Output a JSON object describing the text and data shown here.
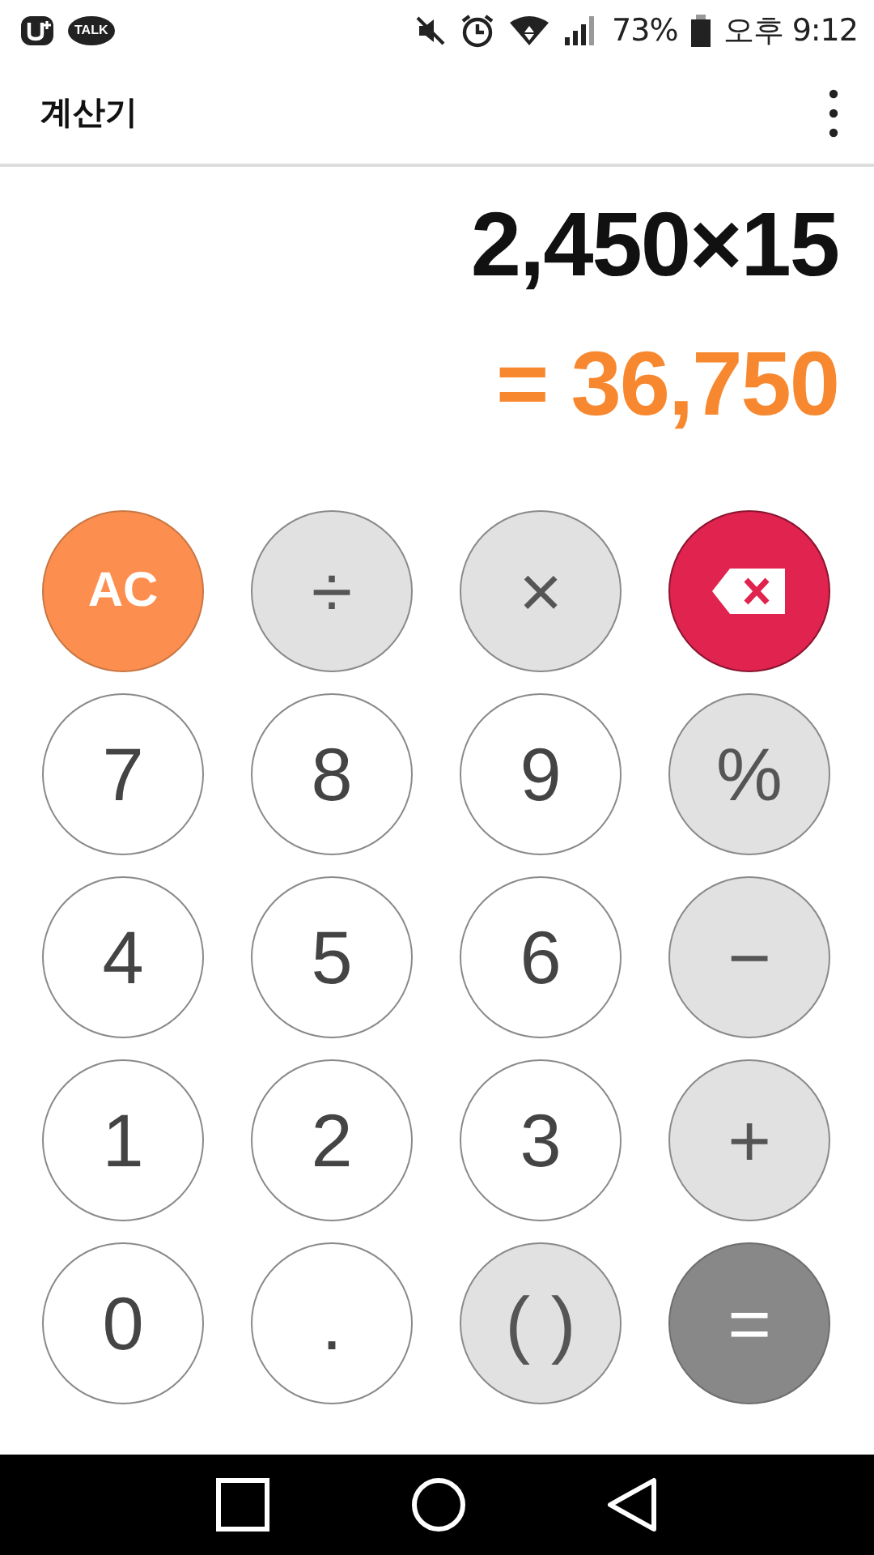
{
  "status_bar": {
    "app_badge": "TALK",
    "battery": "73%",
    "time": "오후 9:12"
  },
  "app_bar": {
    "title": "계산기"
  },
  "display": {
    "expression": "2,450×15",
    "result": "= 36,750"
  },
  "keys": [
    {
      "kind": "clear",
      "label": "AC"
    },
    {
      "kind": "operator",
      "label": "÷"
    },
    {
      "kind": "operator",
      "label": "×"
    },
    {
      "kind": "backspace"
    },
    {
      "kind": "digit",
      "label": "7"
    },
    {
      "kind": "digit",
      "label": "8"
    },
    {
      "kind": "digit",
      "label": "9"
    },
    {
      "kind": "operator",
      "label": "%"
    },
    {
      "kind": "digit",
      "label": "4"
    },
    {
      "kind": "digit",
      "label": "5"
    },
    {
      "kind": "digit",
      "label": "6"
    },
    {
      "kind": "operator",
      "label": "−"
    },
    {
      "kind": "digit",
      "label": "1"
    },
    {
      "kind": "digit",
      "label": "2"
    },
    {
      "kind": "digit",
      "label": "3"
    },
    {
      "kind": "operator",
      "label": "+"
    },
    {
      "kind": "digit",
      "label": "0"
    },
    {
      "kind": "digit",
      "label": "."
    },
    {
      "kind": "operator",
      "label": "( )"
    },
    {
      "kind": "equals",
      "label": "="
    }
  ]
}
